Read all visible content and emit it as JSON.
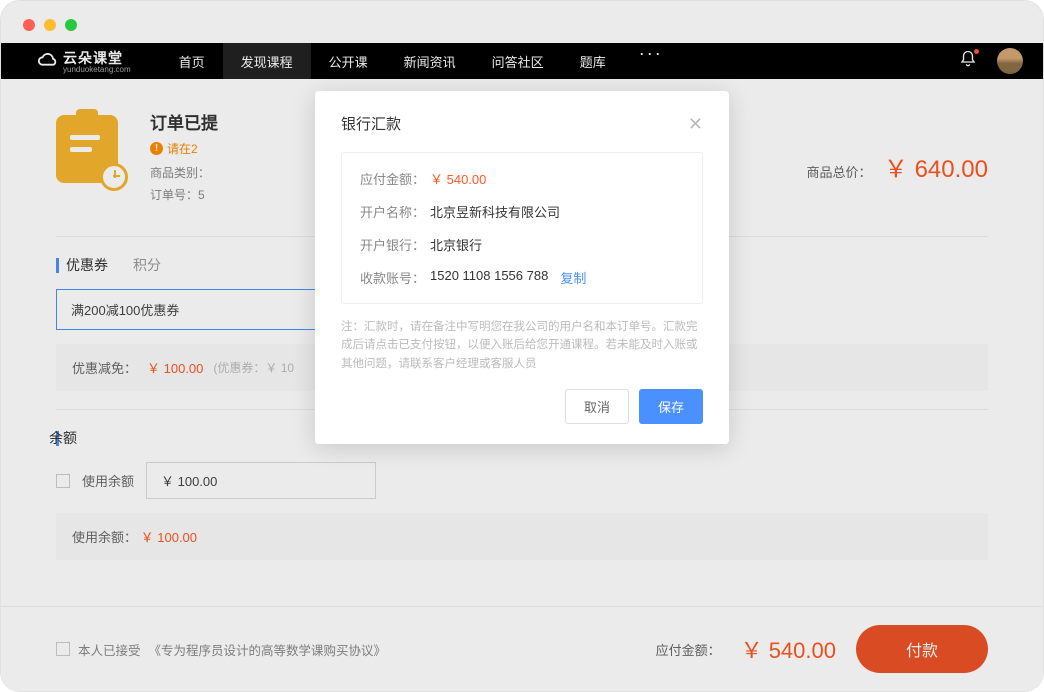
{
  "logo": {
    "text": "云朵课堂",
    "sub": "yunduoketang.com"
  },
  "nav": {
    "items": [
      "首页",
      "发现课程",
      "公开课",
      "新闻资讯",
      "问答社区",
      "题库"
    ],
    "active_index": 1
  },
  "order": {
    "title": "订单已提",
    "warning": "请在2",
    "meta1_label": "商品类别：",
    "meta2_label": "订单号：5",
    "total_label": "商品总价：",
    "total_value": "￥ 640.00"
  },
  "coupon": {
    "tab1": "优惠券",
    "tab2": "积分",
    "selected": "满200减100优惠券",
    "discount_label": "优惠减免：",
    "discount_value": "￥ 100.00",
    "discount_note": "(优惠券：￥ 10"
  },
  "balance": {
    "title": "余额",
    "use_label": "使用余额",
    "input_value": "￥ 100.00",
    "used_label": "使用余额：",
    "used_value": "￥ 100.00"
  },
  "footer": {
    "agree_prefix": "本人已接受",
    "agree_link": "《专为程序员设计的高等数学课购买协议》",
    "pay_label": "应付金额：",
    "pay_amount": "￥ 540.00",
    "pay_btn": "付款"
  },
  "modal": {
    "title": "银行汇款",
    "rows": {
      "amount_label": "应付金额：",
      "amount_value": "￥ 540.00",
      "account_name_label": "开户名称：",
      "account_name_value": "北京昱新科技有限公司",
      "bank_label": "开户银行：",
      "bank_value": "北京银行",
      "account_no_label": "收款账号：",
      "account_no_value": "1520 1108 1556 788",
      "copy": "复制"
    },
    "note": "注：汇款时，请在备注中写明您在我公司的用户名和本订单号。汇款完成后请点击已支付按钮，以便入账后给您开通课程。若未能及时入账或其他问题，请联系客户经理或客服人员",
    "cancel": "取消",
    "save": "保存"
  }
}
